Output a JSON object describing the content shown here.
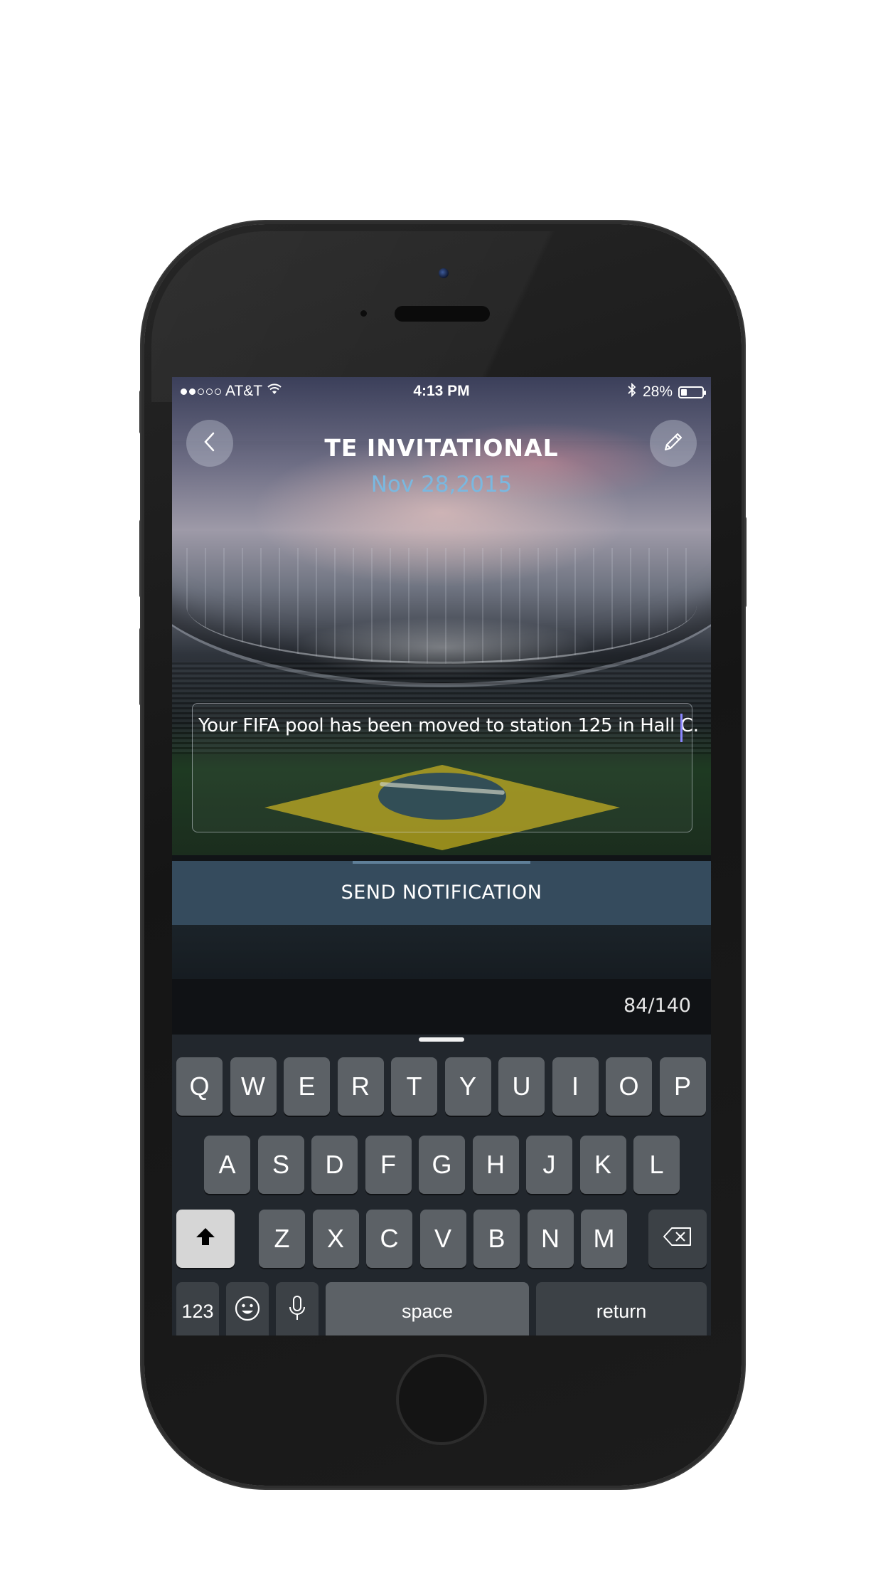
{
  "status_bar": {
    "carrier": "AT&T",
    "time": "4:13 PM",
    "battery_percent": "28%",
    "battery_level": 0.28,
    "signal_bars": 2
  },
  "header": {
    "title": "TE INVITATIONAL",
    "date": "Nov 28,2015",
    "back_icon": "chevron-left-icon",
    "edit_icon": "pencil-icon"
  },
  "message": {
    "text": "Your FIFA pool has been moved to station 125 in Hall C."
  },
  "send_button": {
    "label": "SEND NOTIFICATION"
  },
  "counter": {
    "text": "84/140"
  },
  "keyboard": {
    "row1": [
      "Q",
      "W",
      "E",
      "R",
      "T",
      "Y",
      "U",
      "I",
      "O",
      "P"
    ],
    "row2": [
      "A",
      "S",
      "D",
      "F",
      "G",
      "H",
      "J",
      "K",
      "L"
    ],
    "row3": [
      "Z",
      "X",
      "C",
      "V",
      "B",
      "N",
      "M"
    ],
    "numbers_label": "123",
    "space_label": "space",
    "return_label": "return"
  },
  "colors": {
    "accent_date": "#7ab8e0",
    "send_bar": "#354b5d",
    "caret": "#8a86ff"
  }
}
